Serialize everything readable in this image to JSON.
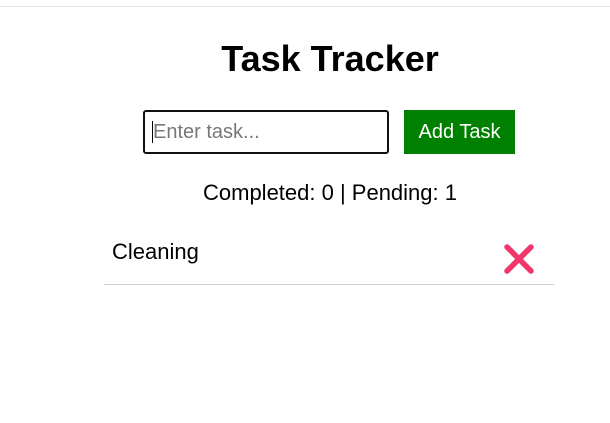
{
  "app": {
    "title": "Task Tracker"
  },
  "form": {
    "input_value": "",
    "input_placeholder": "Enter task...",
    "add_button_label": "Add Task"
  },
  "stats": {
    "text": "Completed: 0 | Pending: 1"
  },
  "tasks": [
    {
      "label": "Cleaning",
      "completed": false,
      "delete_icon": "close-icon"
    }
  ],
  "colors": {
    "add_button_bg": "#008000",
    "delete_icon": "#f0366a"
  }
}
